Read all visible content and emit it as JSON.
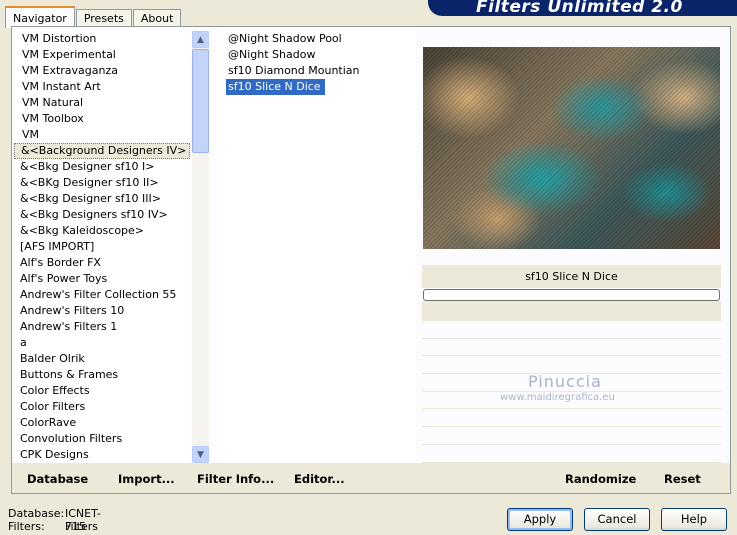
{
  "tabs": [
    "Navigator",
    "Presets",
    "About"
  ],
  "banner_title": "Filters Unlimited 2.0",
  "categories": [
    "VM Distortion",
    "VM Experimental",
    "VM Extravaganza",
    "VM Instant Art",
    "VM Natural",
    "VM Toolbox",
    "VM",
    "&<Background Designers IV>",
    "&<Bkg Designer sf10 I>",
    "&<BKg Designer sf10 II>",
    "&<Bkg Designer sf10 III>",
    "&<Bkg Designers sf10 IV>",
    "&<Bkg Kaleidoscope>",
    "[AFS IMPORT]",
    "Alf's Border FX",
    "Alf's Power Toys",
    "Andrew's Filter Collection 55",
    "Andrew's Filters 10",
    "Andrew's Filters 1",
    "a",
    "Balder Olrik",
    "Buttons & Frames",
    "Color Effects",
    "Color Filters",
    "ColorRave",
    "Convolution Filters",
    "CPK Designs"
  ],
  "filters": [
    "@Night Shadow Pool",
    "@Night Shadow",
    "sf10 Diamond Mountian",
    "sf10 Slice N Dice"
  ],
  "selected_filter_name": "sf10 Slice N Dice",
  "watermark": {
    "name": "Pinuccia",
    "site": "www.maidiregrafica.eu"
  },
  "toolbar": {
    "database": "Database",
    "import": "Import...",
    "filter_info": "Filter Info...",
    "editor": "Editor...",
    "randomize": "Randomize",
    "reset": "Reset"
  },
  "status": {
    "database_label": "Database:",
    "database_value": "ICNET-Filters",
    "filters_label": "Filters:",
    "filters_value": "715"
  },
  "buttons": {
    "apply": "Apply",
    "cancel": "Cancel",
    "help": "Help"
  }
}
